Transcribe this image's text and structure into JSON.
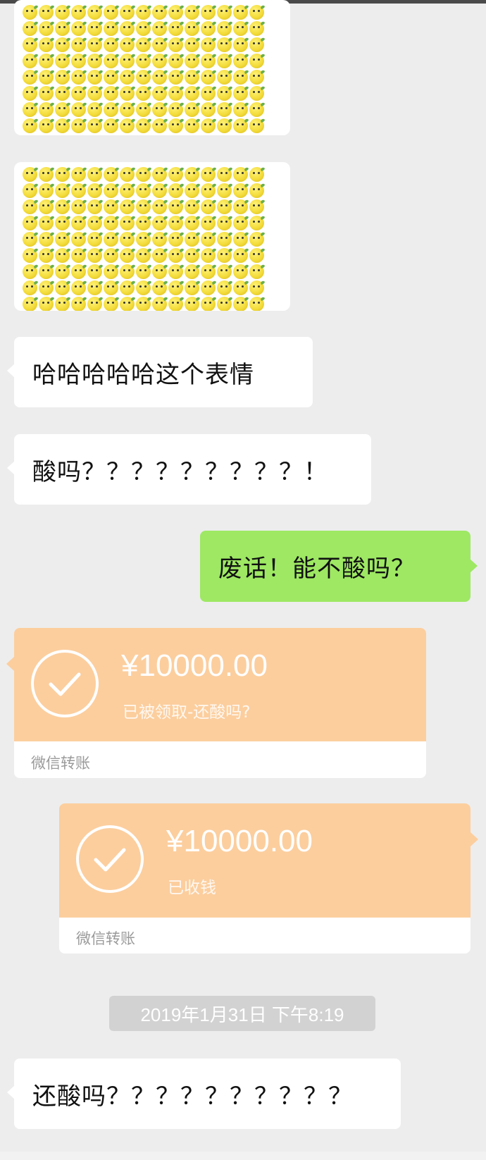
{
  "messages": {
    "sticker_1": {
      "icon": "lemon-emoji",
      "rows": 8,
      "cols": 15
    },
    "sticker_2": {
      "icon": "lemon-emoji",
      "rows": 9,
      "cols": 15
    },
    "msg_haha": "哈哈哈哈哈这个表情",
    "msg_suan": "酸吗？？？？？？？？？！",
    "msg_reply": "废话！能不酸吗？",
    "transfer_1": {
      "amount": "¥10000.00",
      "status": "已被领取-还酸吗?",
      "footer": "微信转账"
    },
    "transfer_2": {
      "amount": "¥10000.00",
      "status": "已收钱",
      "footer": "微信转账"
    },
    "timestamp": "2019年1月31日 下午8:19",
    "msg_last": "还酸吗？？？？？？？？？？"
  },
  "colors": {
    "background": "#ededed",
    "my_bubble": "#9ee863",
    "their_bubble": "#ffffff",
    "transfer_orange": "#fcce9e"
  }
}
